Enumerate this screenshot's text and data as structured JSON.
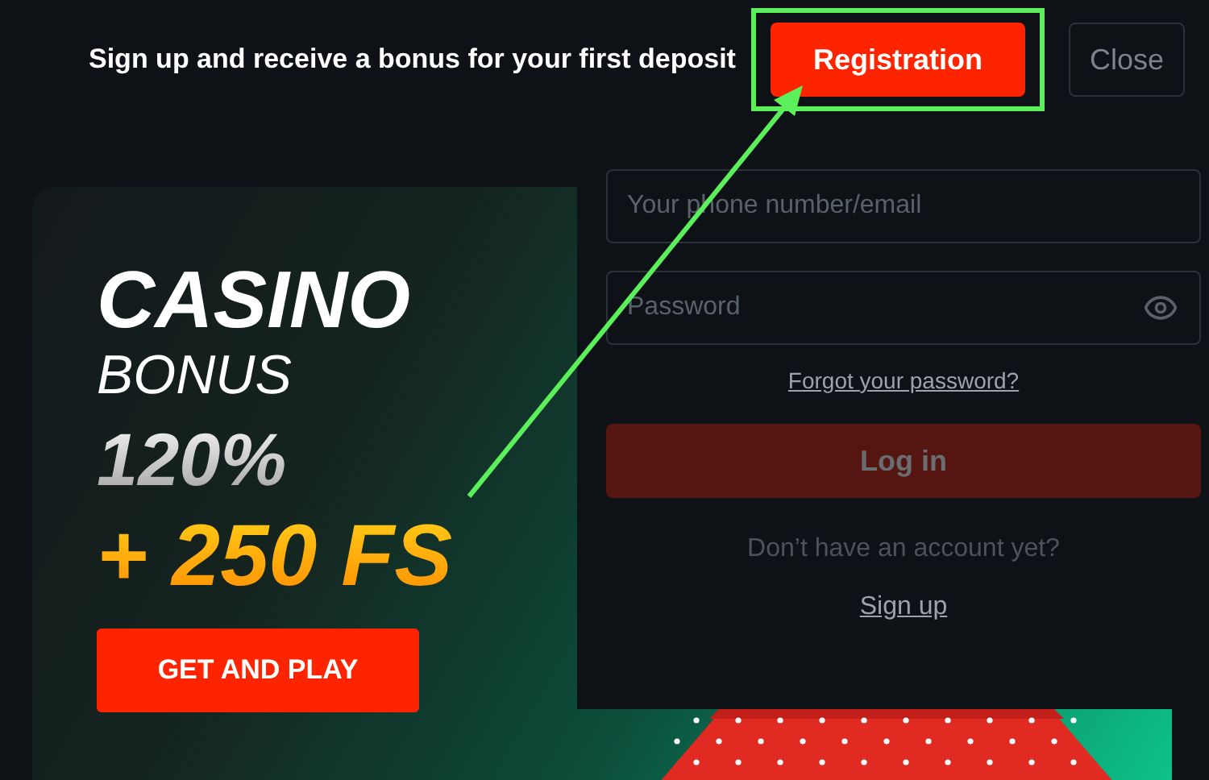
{
  "banner_bar": {
    "message": "Sign up and receive a bonus for your first deposit",
    "buttons": [
      {
        "label": "Registration",
        "kind": "primary",
        "highlighted": true
      },
      {
        "label": "Close",
        "kind": "secondary",
        "highlighted": false
      }
    ]
  },
  "promo": {
    "title": "CASINO",
    "subtitle": "BONUS",
    "percent": "120%",
    "free_spins": "+ 250 FS",
    "button": "GET AND PLAY"
  },
  "login": {
    "fields": [
      {
        "placeholder": "Your phone number/email",
        "kind": "text"
      },
      {
        "placeholder": "Password",
        "kind": "password"
      }
    ],
    "forgot_link": "Forgot your password?",
    "login_button": {
      "label": "Log in",
      "disabled": true
    },
    "signup_prompt": "Don’t have an account yet?",
    "signup_link": "Sign up"
  }
}
